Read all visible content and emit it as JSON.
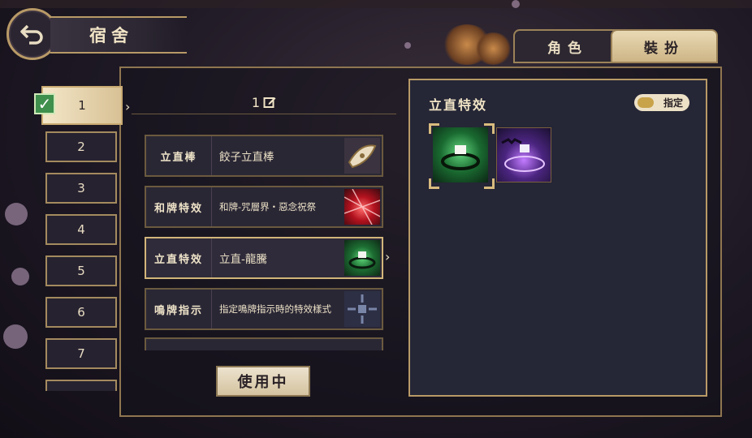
{
  "header": {
    "title": "宿舍"
  },
  "tabs": [
    {
      "label": "角色",
      "active": false
    },
    {
      "label": "裝扮",
      "active": true
    }
  ],
  "slots": [
    "1",
    "2",
    "3",
    "4",
    "5",
    "6",
    "7"
  ],
  "loadout": {
    "name": "1"
  },
  "items": [
    {
      "category": "立直棒",
      "name": "餃子立直棒",
      "icon": "stick-icon"
    },
    {
      "category": "和牌特效",
      "name": "和牌-咒層界・惡念祝祭",
      "icon": "red-beam-icon"
    },
    {
      "category": "立直特效",
      "name": "立直-龍騰",
      "icon": "green-vortex-icon"
    },
    {
      "category": "鳴牌指示",
      "name": "指定鳴牌指示時的特效樣式",
      "icon": "tile-pattern-icon"
    }
  ],
  "buttons": {
    "in_use": "使用中"
  },
  "right_panel": {
    "title": "立直特效",
    "toggle_label": "指定",
    "effects": [
      "green-vortex-effect",
      "purple-bat-ring-effect"
    ]
  },
  "colors": {
    "accent_gold": "#b89a67",
    "panel": "#252636"
  }
}
